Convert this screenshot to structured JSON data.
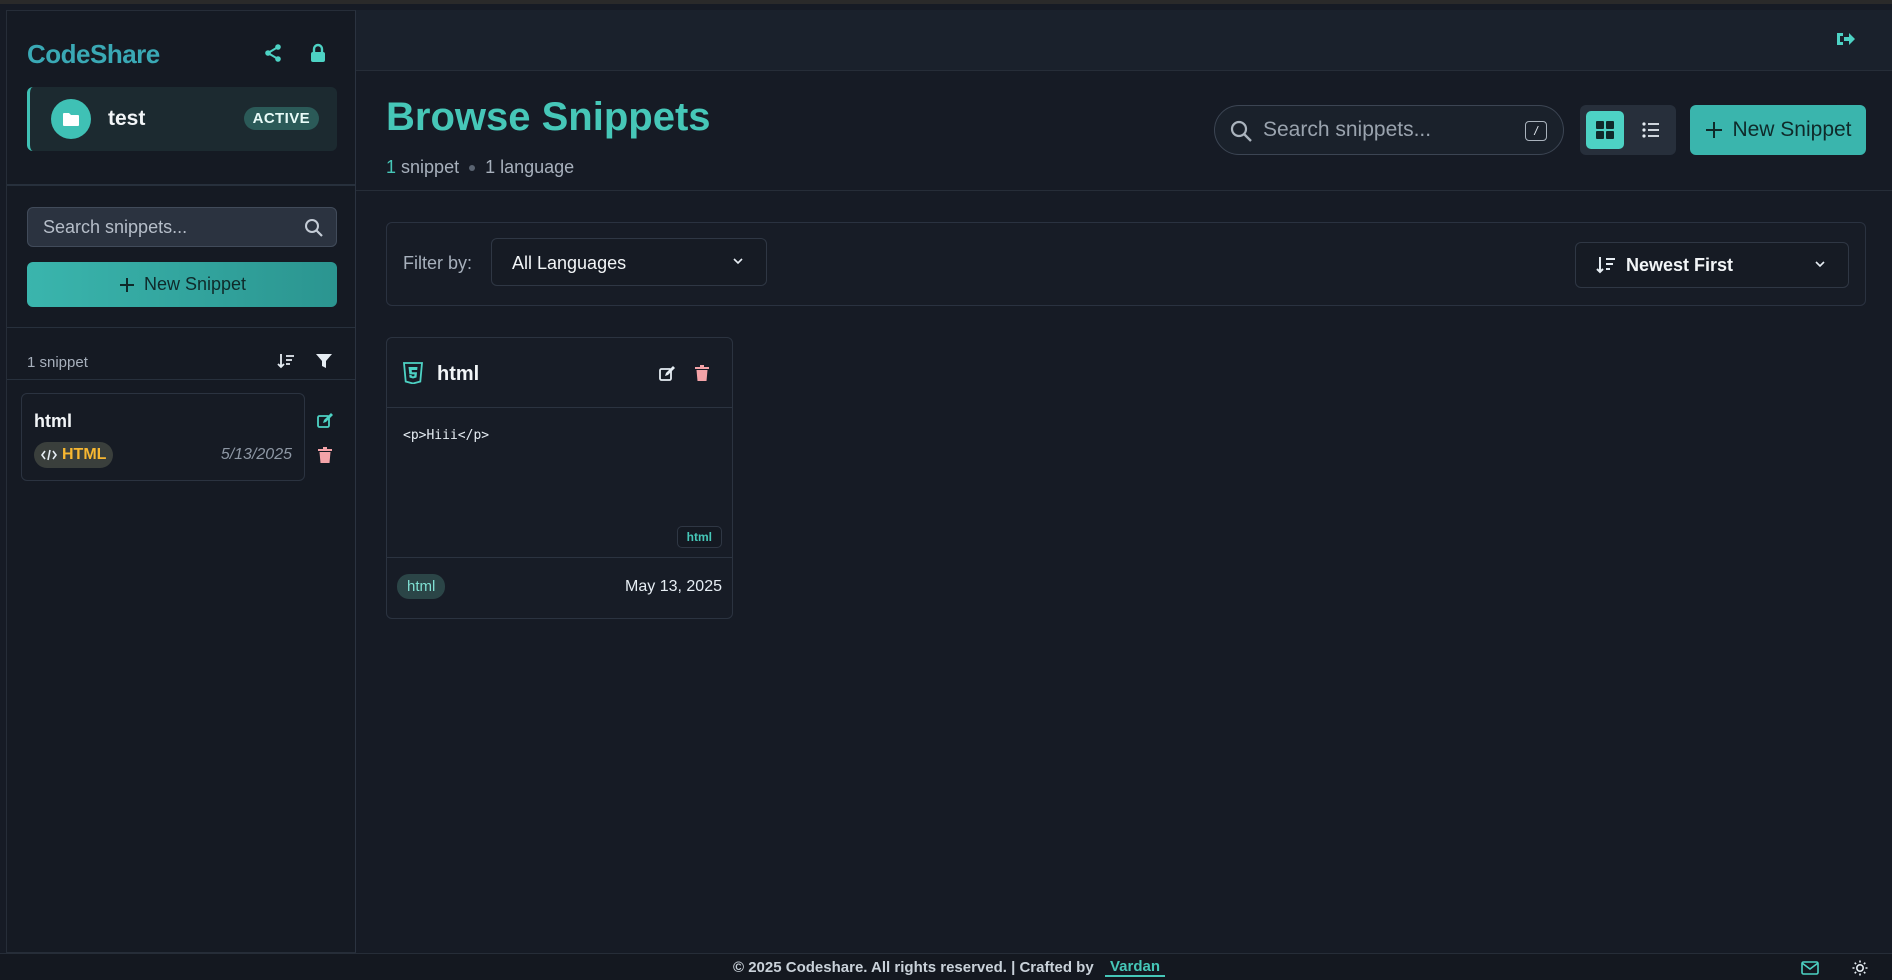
{
  "app": {
    "brand": "CodeShare"
  },
  "workspace": {
    "name": "test",
    "status": "ACTIVE"
  },
  "sidebar": {
    "search_placeholder": "Search snippets...",
    "new_button": "New Snippet",
    "count": "1 snippet",
    "items": [
      {
        "title": "html",
        "language": "HTML",
        "date": "5/13/2025"
      }
    ]
  },
  "header": {
    "title": "Browse Snippets",
    "snippet_count": "1",
    "snippet_label": "snippet",
    "language_count": "1 language",
    "search_placeholder": "Search snippets...",
    "search_shortcut": "/",
    "new_button": "New Snippet"
  },
  "filters": {
    "label": "Filter by:",
    "language": "All Languages",
    "sort": "Newest First"
  },
  "snippets": [
    {
      "title": "html",
      "code": "<p>Hiii</p>",
      "code_tag": "html",
      "tag": "html",
      "date": "May 13, 2025"
    }
  ],
  "footer": {
    "text": "© 2025 Codeshare. All rights reserved. | Crafted by",
    "author": "Vardan"
  },
  "colors": {
    "accent": "#46c7b8",
    "danger": "#f4a3a8",
    "html_badge": "#f7b731"
  },
  "icons": [
    "share-icon",
    "lock-icon",
    "folder-icon",
    "search-icon",
    "plus-icon",
    "sort-icon",
    "filter-icon",
    "edit-icon",
    "trash-icon",
    "code-icon",
    "logout-icon",
    "grid-icon",
    "list-icon",
    "chevron-down-icon",
    "html5-icon",
    "mail-icon",
    "sun-icon"
  ]
}
